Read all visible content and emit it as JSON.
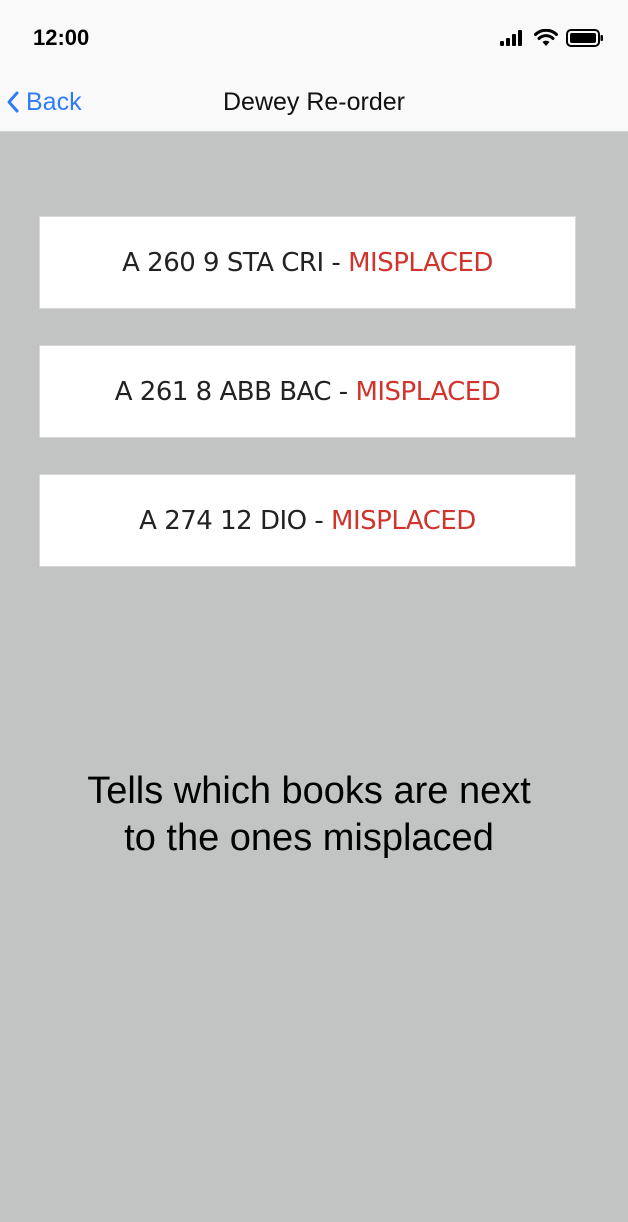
{
  "status_bar": {
    "time": "12:00",
    "icons": [
      "signal-icon",
      "wifi-icon",
      "battery-icon"
    ]
  },
  "nav": {
    "back_label": "Back",
    "title": "Dewey Re-order"
  },
  "results": [
    {
      "code": "A 260 9 STA CRI",
      "separator": " - ",
      "status": "MISPLACED"
    },
    {
      "code": "A 261 8 ABB BAC",
      "separator": " - ",
      "status": "MISPLACED"
    },
    {
      "code": "A 274 12 DIO",
      "separator": " - ",
      "status": "MISPLACED"
    }
  ],
  "caption": {
    "line1": "Tells which books are next",
    "line2": "to the ones misplaced"
  },
  "colors": {
    "background": "#c1c4c3",
    "accent": "#2f7cf6",
    "misplaced": "#d0342c"
  }
}
